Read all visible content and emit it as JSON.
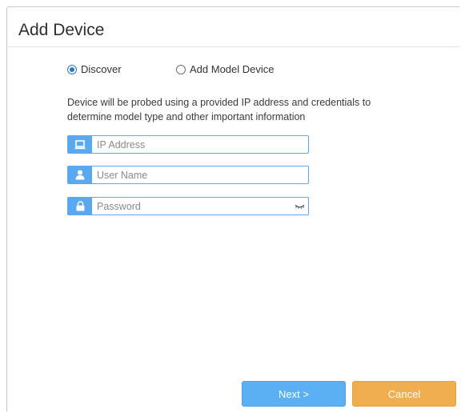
{
  "dialog": {
    "title": "Add Device"
  },
  "mode": {
    "options": [
      {
        "label": "Discover",
        "selected": true
      },
      {
        "label": "Add Model Device",
        "selected": false
      }
    ]
  },
  "description": "Device will be probed using a provided IP address and credentials to determine model type and other important information",
  "fields": {
    "ip_address": {
      "icon": "computer-icon",
      "placeholder": "IP Address",
      "value": ""
    },
    "user_name": {
      "icon": "user-icon",
      "placeholder": "User Name",
      "value": ""
    },
    "password": {
      "icon": "lock-icon",
      "placeholder": "Password",
      "value": "",
      "toggle_icon": "eye-closed-icon"
    }
  },
  "buttons": {
    "next_label": "Next >",
    "cancel_label": "Cancel"
  },
  "colors": {
    "accent": "#5aa8ef",
    "next_button": "#5ab0f2",
    "cancel_button": "#f1ae4e",
    "radio_selected": "#2b78c5"
  }
}
